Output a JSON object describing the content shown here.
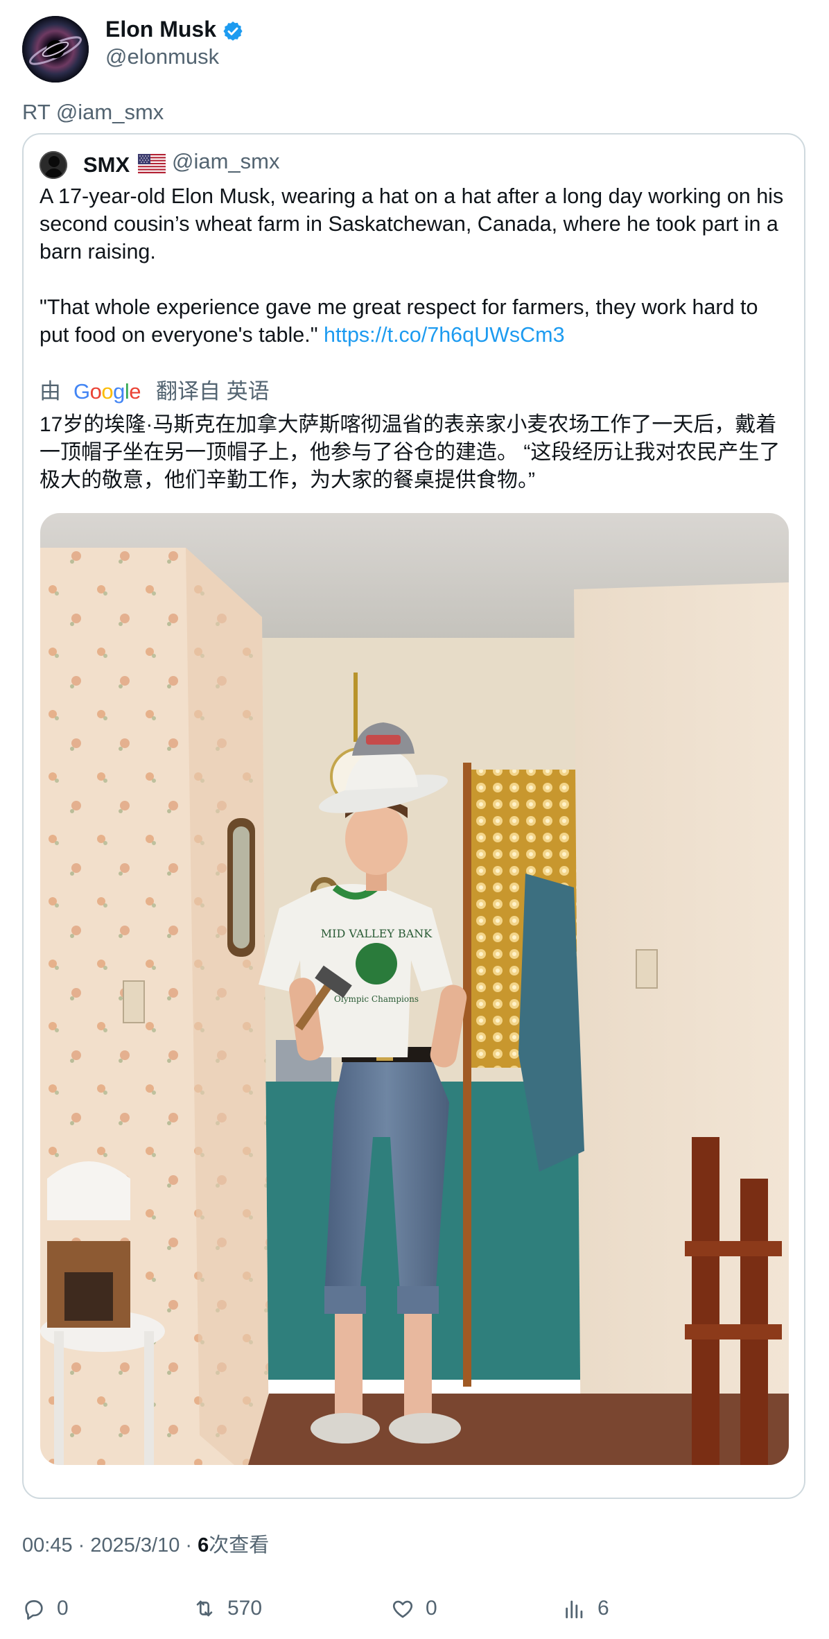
{
  "author": {
    "name": "Elon Musk",
    "handle": "@elonmusk",
    "verified_icon": "verified-badge-icon",
    "badge_color": "#1d9bf0"
  },
  "retweet_label": "RT @iam_smx",
  "quoted": {
    "name": "SMX",
    "flag_icon": "us-flag-icon",
    "handle": "@iam_smx",
    "text": "A 17-year-old Elon Musk, wearing a hat on a hat after a long day working on his second cousin’s wheat farm in Saskatchewan, Canada, where he took part in a barn raising.\n\n\"That whole experience gave me great respect for farmers, they work hard to put food on everyone's table.\" ",
    "link": "https://t.co/7h6qUWsCm3",
    "link_color": "#1d9bf0",
    "translation": {
      "prefix": "由",
      "provider": "Google",
      "suffix": "翻译自 英语",
      "text": "17岁的埃隆·马斯克在加拿大萨斯喀彻温省的表亲家小麦农场工作了一天后，戴着一顶帽子坐在另一顶帽子上，他参与了谷仓的建造。 “这段经历让我对农民产生了极大的敬意，他们辛勤工作，为大家的餐桌提供食物。”"
    },
    "photo": {
      "shirt_text_top": "MID VALLEY BANK",
      "shirt_text_bottom": "Olympic Champions"
    }
  },
  "meta": {
    "time": "00:45",
    "date": "2025/3/10",
    "views_count": "6",
    "views_label": "次查看"
  },
  "actions": {
    "reply": "0",
    "retweet": "570",
    "like": "0",
    "views": "6"
  }
}
